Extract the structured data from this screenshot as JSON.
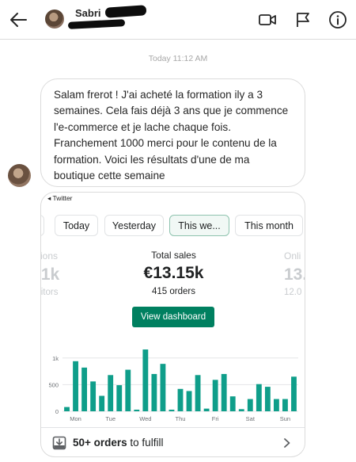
{
  "header": {
    "username": "Sabri",
    "back_icon": "arrow-left-icon",
    "video_icon": "video-camera-icon",
    "flag_icon": "flag-icon",
    "info_icon": "info-icon"
  },
  "thread": {
    "timestamp": "Today 11:12 AM",
    "message": "Salam frerot ! J'ai acheté la formation ily a 3 semaines. Cela fais déjà 3 ans que je commence l'e-commerce et je lache chaque fois. Franchement 1000 merci pour le contenu de la formation. Voici les résultats d'une de ma boutique cette semaine"
  },
  "shared_screenshot": {
    "status_back": "◂ Twitter",
    "tabs": [
      {
        "label": "e",
        "active": false
      },
      {
        "label": "Today",
        "active": false
      },
      {
        "label": "Yesterday",
        "active": false
      },
      {
        "label": "This we...",
        "active": true
      },
      {
        "label": "This month",
        "active": false
      }
    ],
    "left_stat": {
      "label": "sions",
      "value": ".1k",
      "sub": "sitors"
    },
    "center_stat": {
      "label": "Total sales",
      "value": "€13.15k",
      "sub": "415 orders"
    },
    "right_stat": {
      "label": "Onli",
      "value": "13.",
      "sub": "12.0"
    },
    "view_button": "View dashboard",
    "footer": {
      "bold": "50+ orders",
      "rest": " to fulfill",
      "icon": "download-tray-icon",
      "chevron": "chevron-right-icon"
    },
    "accent": "#008060",
    "bar_color": "#0f9e8a"
  },
  "chart_data": {
    "type": "bar",
    "ylim": [
      0,
      1000
    ],
    "y_ticks": [
      "0",
      "500",
      "1k"
    ],
    "y_tick_values": [
      0,
      500,
      1000
    ],
    "x_labels": [
      "Mon",
      "Tue",
      "Wed",
      "Thu",
      "Fri",
      "Sat",
      "Sun"
    ],
    "values": [
      80,
      940,
      820,
      560,
      290,
      680,
      490,
      780,
      30,
      1160,
      700,
      890,
      30,
      420,
      380,
      680,
      50,
      590,
      700,
      280,
      40,
      230,
      510,
      460,
      230,
      230,
      650
    ]
  }
}
